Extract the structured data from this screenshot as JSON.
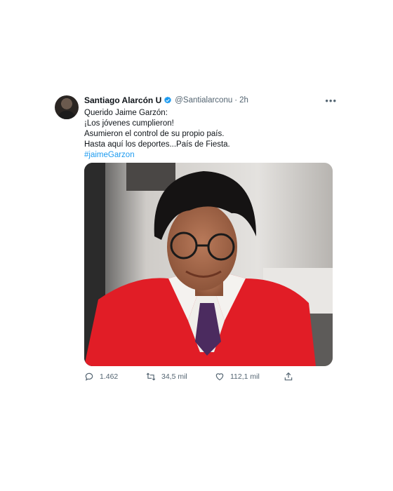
{
  "tweet": {
    "author": {
      "name": "Santiago Alarcón U",
      "handle": "@Santialarconu",
      "time": "2h"
    },
    "text_lines": [
      "Querido Jaime Garzón:",
      "¡Los jóvenes cumplieron!",
      "Asumieron el control de su propio país.",
      "Hasta aquí los deportes...País de Fiesta."
    ],
    "hashtag": "#jaimeGarzon",
    "photo_alt_icon": "portrait-photo",
    "stats": {
      "replies": "1.462",
      "retweets": "34,5 mil",
      "likes": "112,1 mil"
    },
    "colors": {
      "link": "#1d9bf0",
      "secondary_text": "#536471",
      "verified": "#1d9bf0"
    }
  }
}
